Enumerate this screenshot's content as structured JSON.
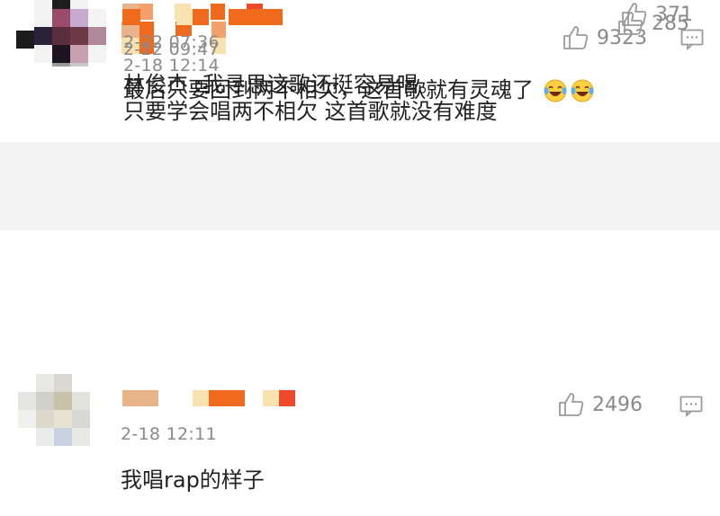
{
  "comments": [
    {
      "time": "2-18 12:14",
      "likes": "9323",
      "text": "只要学会唱两不相欠 这首歌就没有难度"
    },
    {
      "time": "2-18 12:11",
      "likes": "2496",
      "text": "我唱rap的样子"
    }
  ],
  "replies": [
    {
      "time": "2-22 07:36",
      "likes": "371",
      "author": "林俊杰",
      "text": "林俊杰 :我寻思这歌还挺容易唱。"
    },
    {
      "time": "2-22 09:47",
      "likes": "285",
      "text": "最后只要回到两不相欠，这首歌就有灵魂了"
    }
  ],
  "icons": {
    "like": "thumbs-up-icon",
    "reply": "comment-icon",
    "emoji": "laughing-crying-emoji-icon"
  },
  "colors": {
    "orange": "#f06a1e",
    "orange_light": "#f4a06a",
    "peach": "#e9b48a",
    "yellow_light": "#f8e2b0",
    "red": "#ee4a2a",
    "text": "#222222",
    "meta": "#8a8a8a",
    "reply_bg": "#f3f3f3"
  }
}
